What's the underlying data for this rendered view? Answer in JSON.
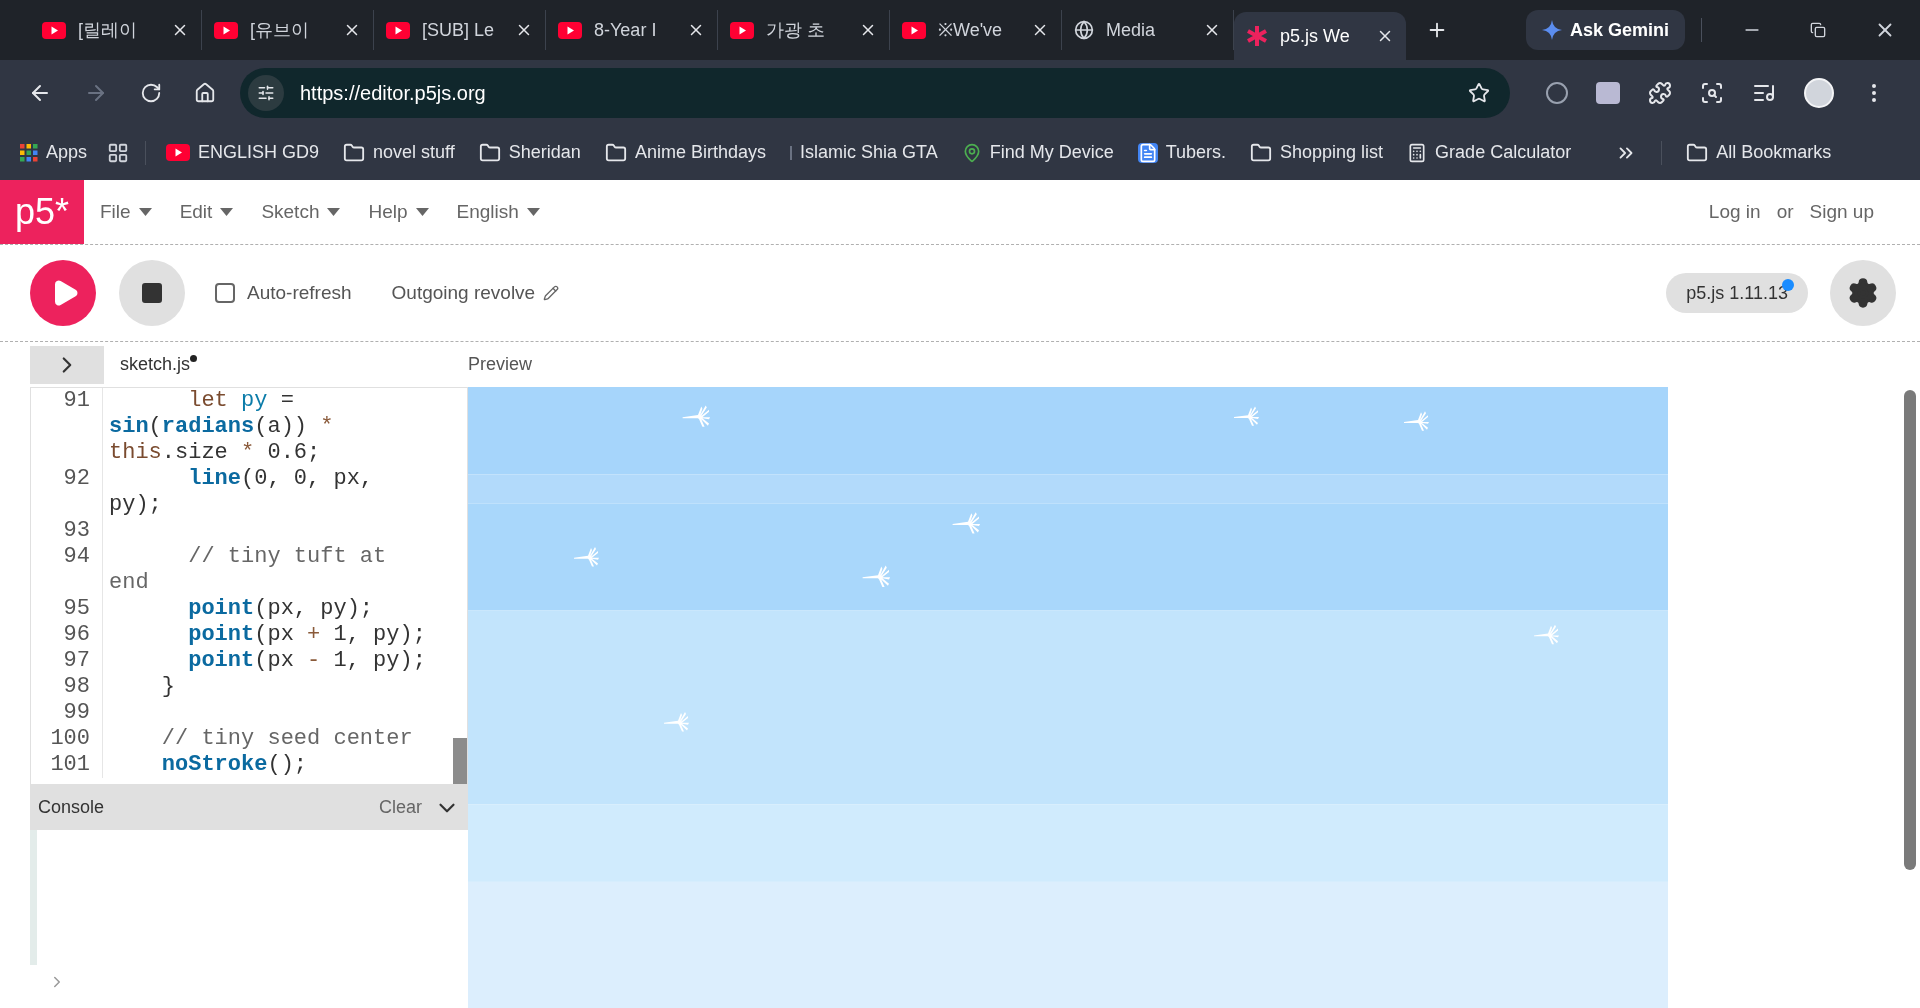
{
  "browser": {
    "tabs": [
      {
        "title": "[릴레이",
        "kind": "video",
        "selected": false
      },
      {
        "title": "[유브이",
        "kind": "video",
        "selected": false
      },
      {
        "title": "[SUB] Le",
        "kind": "video",
        "selected": false
      },
      {
        "title": "8-Year I",
        "kind": "video",
        "selected": false
      },
      {
        "title": "가광 초",
        "kind": "video",
        "selected": false
      },
      {
        "title": "※We've",
        "kind": "video",
        "selected": false
      },
      {
        "title": "Media",
        "kind": "globe",
        "selected": false
      },
      {
        "title": "p5.js We",
        "kind": "p5",
        "selected": true
      }
    ],
    "ask_button": "Ask Gemini",
    "url": "https://editor.p5js.org",
    "bookmarks": [
      {
        "label": "Apps",
        "kind": "apps"
      },
      {
        "label": "ENGLISH GD9",
        "kind": "video"
      },
      {
        "label": "novel stuff",
        "kind": "folder"
      },
      {
        "label": "Sheridan",
        "kind": "folder"
      },
      {
        "label": "Anime Birthdays",
        "kind": "folder"
      },
      {
        "label": "Islamic Shia GTA",
        "kind": "blank"
      },
      {
        "label": "Find My Device",
        "kind": "pin"
      },
      {
        "label": "Tubers.",
        "kind": "doc"
      },
      {
        "label": "Shopping list",
        "kind": "folder"
      },
      {
        "label": "Grade Calculator",
        "kind": "calc"
      }
    ],
    "all_bookmarks": "All Bookmarks"
  },
  "app": {
    "logo": "p5*",
    "menu": [
      "File",
      "Edit",
      "Sketch",
      "Help",
      "English"
    ],
    "login": "Log in",
    "or": "or",
    "signup": "Sign up",
    "auto_refresh": {
      "label": "Auto-refresh",
      "checked": false
    },
    "sketch_name": "Outgoing revolve",
    "version": "p5.js 1.11.13",
    "update_dot": true
  },
  "editor": {
    "file": "sketch.js",
    "unsaved": true,
    "preview_label": "Preview",
    "lines": [
      {
        "n": "91",
        "segs": [
          {
            "kind": "kw",
            "text": "      let "
          },
          {
            "kind": "v",
            "text": "py"
          },
          {
            "kind": "p",
            "text": " = "
          },
          {
            "kind": "fn",
            "text": "sin"
          },
          {
            "kind": "p",
            "text": "("
          },
          {
            "kind": "fn",
            "text": "radians"
          },
          {
            "kind": "p",
            "text": "(a)) "
          },
          {
            "kind": "op",
            "text": "*"
          },
          {
            "kind": "kw",
            "text": " this"
          },
          {
            "kind": "p",
            "text": ".size "
          },
          {
            "kind": "op",
            "text": "*"
          },
          {
            "kind": "p",
            "text": " 0.6;"
          }
        ]
      },
      {
        "n": "92",
        "segs": [
          {
            "kind": "fn",
            "text": "      line"
          },
          {
            "kind": "p",
            "text": "(0, 0, px, py);"
          }
        ]
      },
      {
        "n": "93"
      },
      {
        "n": "94",
        "segs": [
          {
            "kind": "c",
            "text": "      // tiny tuft at end"
          }
        ]
      },
      {
        "n": "95",
        "segs": [
          {
            "kind": "fn",
            "text": "      point"
          },
          {
            "kind": "p",
            "text": "(px, py);"
          }
        ]
      },
      {
        "n": "96",
        "segs": [
          {
            "kind": "fn",
            "text": "      point"
          },
          {
            "kind": "p",
            "text": "(px "
          },
          {
            "kind": "op",
            "text": "+"
          },
          {
            "kind": "p",
            "text": " 1, py);"
          }
        ]
      },
      {
        "n": "97",
        "segs": [
          {
            "kind": "fn",
            "text": "      point"
          },
          {
            "kind": "p",
            "text": "(px "
          },
          {
            "kind": "op",
            "text": "-"
          },
          {
            "kind": "p",
            "text": " 1, py);"
          }
        ]
      },
      {
        "n": "98",
        "segs": [
          {
            "kind": "p",
            "text": "    }"
          }
        ]
      },
      {
        "n": "99"
      },
      {
        "n": "100",
        "segs": [
          {
            "kind": "c",
            "text": "    // tiny seed center"
          }
        ]
      },
      {
        "n": "101",
        "segs": [
          {
            "kind": "fn",
            "text": "    noStroke"
          },
          {
            "kind": "p",
            "text": "();"
          }
        ]
      }
    ]
  },
  "console": {
    "title": "Console",
    "clear": "Clear"
  }
}
